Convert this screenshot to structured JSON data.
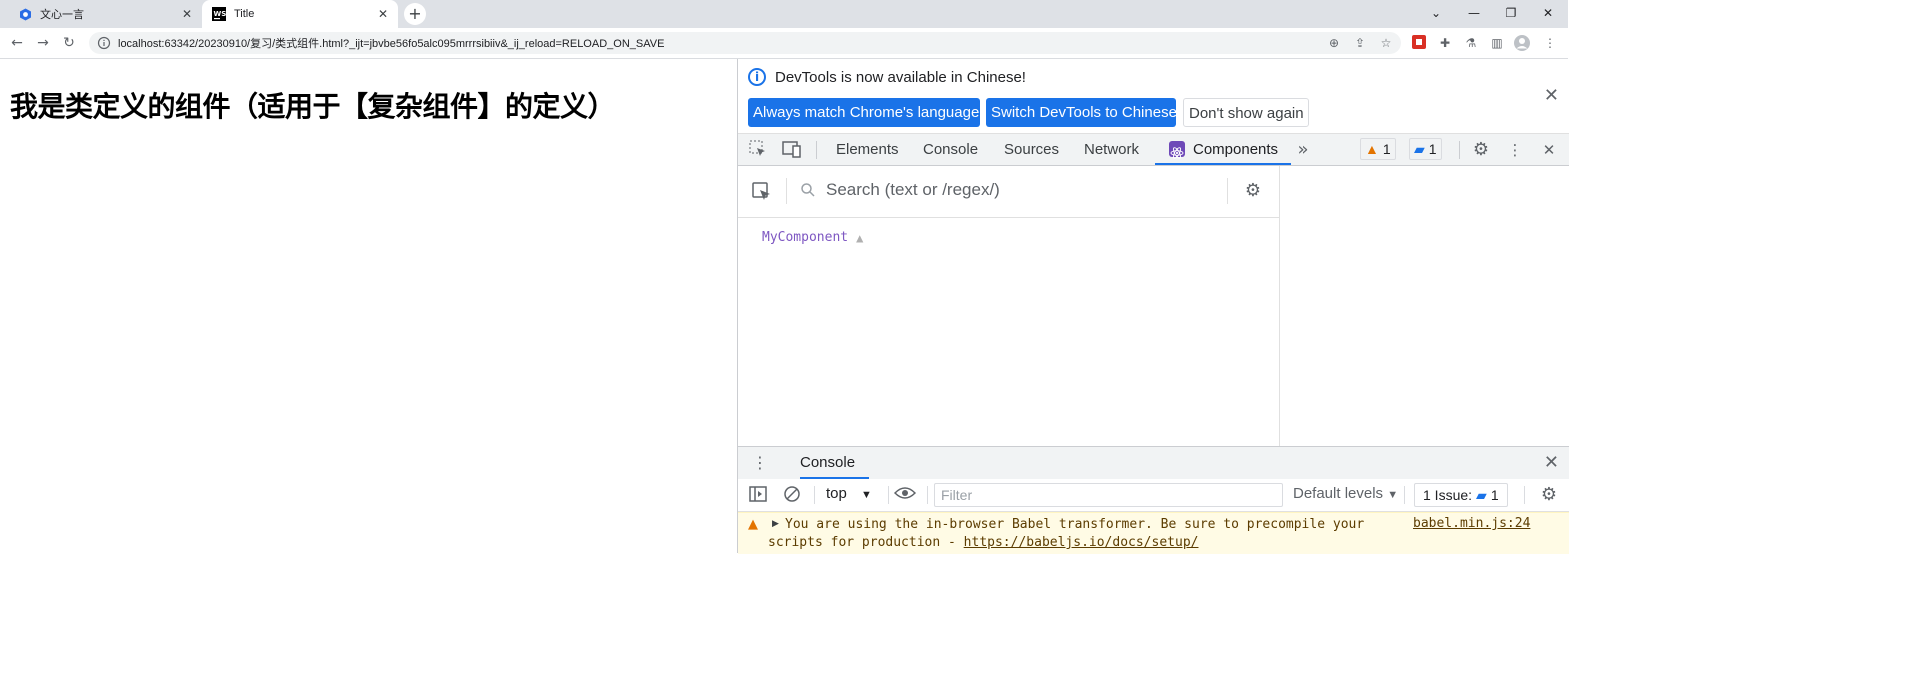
{
  "browser": {
    "tabs": [
      {
        "title": "文心一言",
        "icon": "wenxin-icon",
        "active": false
      },
      {
        "title": "Title",
        "icon": "webstorm-icon",
        "active": true
      }
    ],
    "new_tab": "+",
    "address": {
      "url": "localhost:63342/20230910/复习/类式组件.html?_ijt=jbvbe56fo5alc095mrrrsibiiv&_ij_reload=RELOAD_ON_SAVE"
    }
  },
  "page": {
    "heading": "我是类定义的组件（适用于【复杂组件】的定义）"
  },
  "devtools": {
    "infobar": {
      "message": "DevTools is now available in Chinese!",
      "btn_match": "Always match Chrome's language",
      "btn_switch": "Switch DevTools to Chinese",
      "btn_dismiss": "Don't show again"
    },
    "tabs": [
      "Elements",
      "Console",
      "Sources",
      "Network",
      "Components"
    ],
    "active_tab": "Components",
    "warnings_count": "1",
    "messages_count": "1",
    "components": {
      "search_placeholder": "Search (text or /regex/)",
      "tree": [
        {
          "name": "MyComponent",
          "has_warning": true
        }
      ]
    },
    "drawer": {
      "tab": "Console",
      "context": "top",
      "filter_placeholder": "Filter",
      "levels": "Default levels",
      "issues_label": "1 Issue:",
      "issues_count": "1",
      "warning": {
        "line1": "You are using the in-browser Babel transformer. Be sure to precompile your",
        "line2_prefix": "scripts for production - ",
        "link": "https://babeljs.io/docs/setup/",
        "source": "babel.min.js:24"
      }
    }
  },
  "colors": {
    "accent": "#1a73e8",
    "tabbar": "#dee1e6",
    "component_name": "#7e57c2",
    "warning_bg": "#fffbe5",
    "warning_icon": "#e37400"
  }
}
